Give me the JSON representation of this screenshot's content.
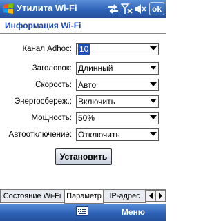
{
  "titlebar": {
    "title": "Утилита Wi-Fi",
    "ok_label": "ok"
  },
  "header": {
    "section_title": "Информация Wi-Fi"
  },
  "form": {
    "fields": [
      {
        "label": "Канал Adhoc:",
        "value": "10"
      },
      {
        "label": "Заголовок:",
        "value": "Длинный"
      },
      {
        "label": "Скорость:",
        "value": "Авто"
      },
      {
        "label": "Энергосбереж.:",
        "value": "Включить"
      },
      {
        "label": "Мощность:",
        "value": "50%"
      },
      {
        "label": "Автоотключение:",
        "value": "Отключить"
      }
    ],
    "set_button": "Установить"
  },
  "tabs": [
    {
      "label": "Состояние Wi-Fi",
      "active": false
    },
    {
      "label": "Параметр",
      "active": true
    },
    {
      "label": "IP-адрес",
      "active": false
    }
  ],
  "bottombar": {
    "menu_label": "Меню"
  },
  "colors": {
    "accent": "#2f63b8",
    "section_title": "#1d46b0",
    "selection": "#1c4fb8"
  },
  "icons": [
    "windows-logo-icon",
    "connectivity-icon",
    "signal-off-icon",
    "speaker-muted-icon",
    "keyboard-icon"
  ]
}
